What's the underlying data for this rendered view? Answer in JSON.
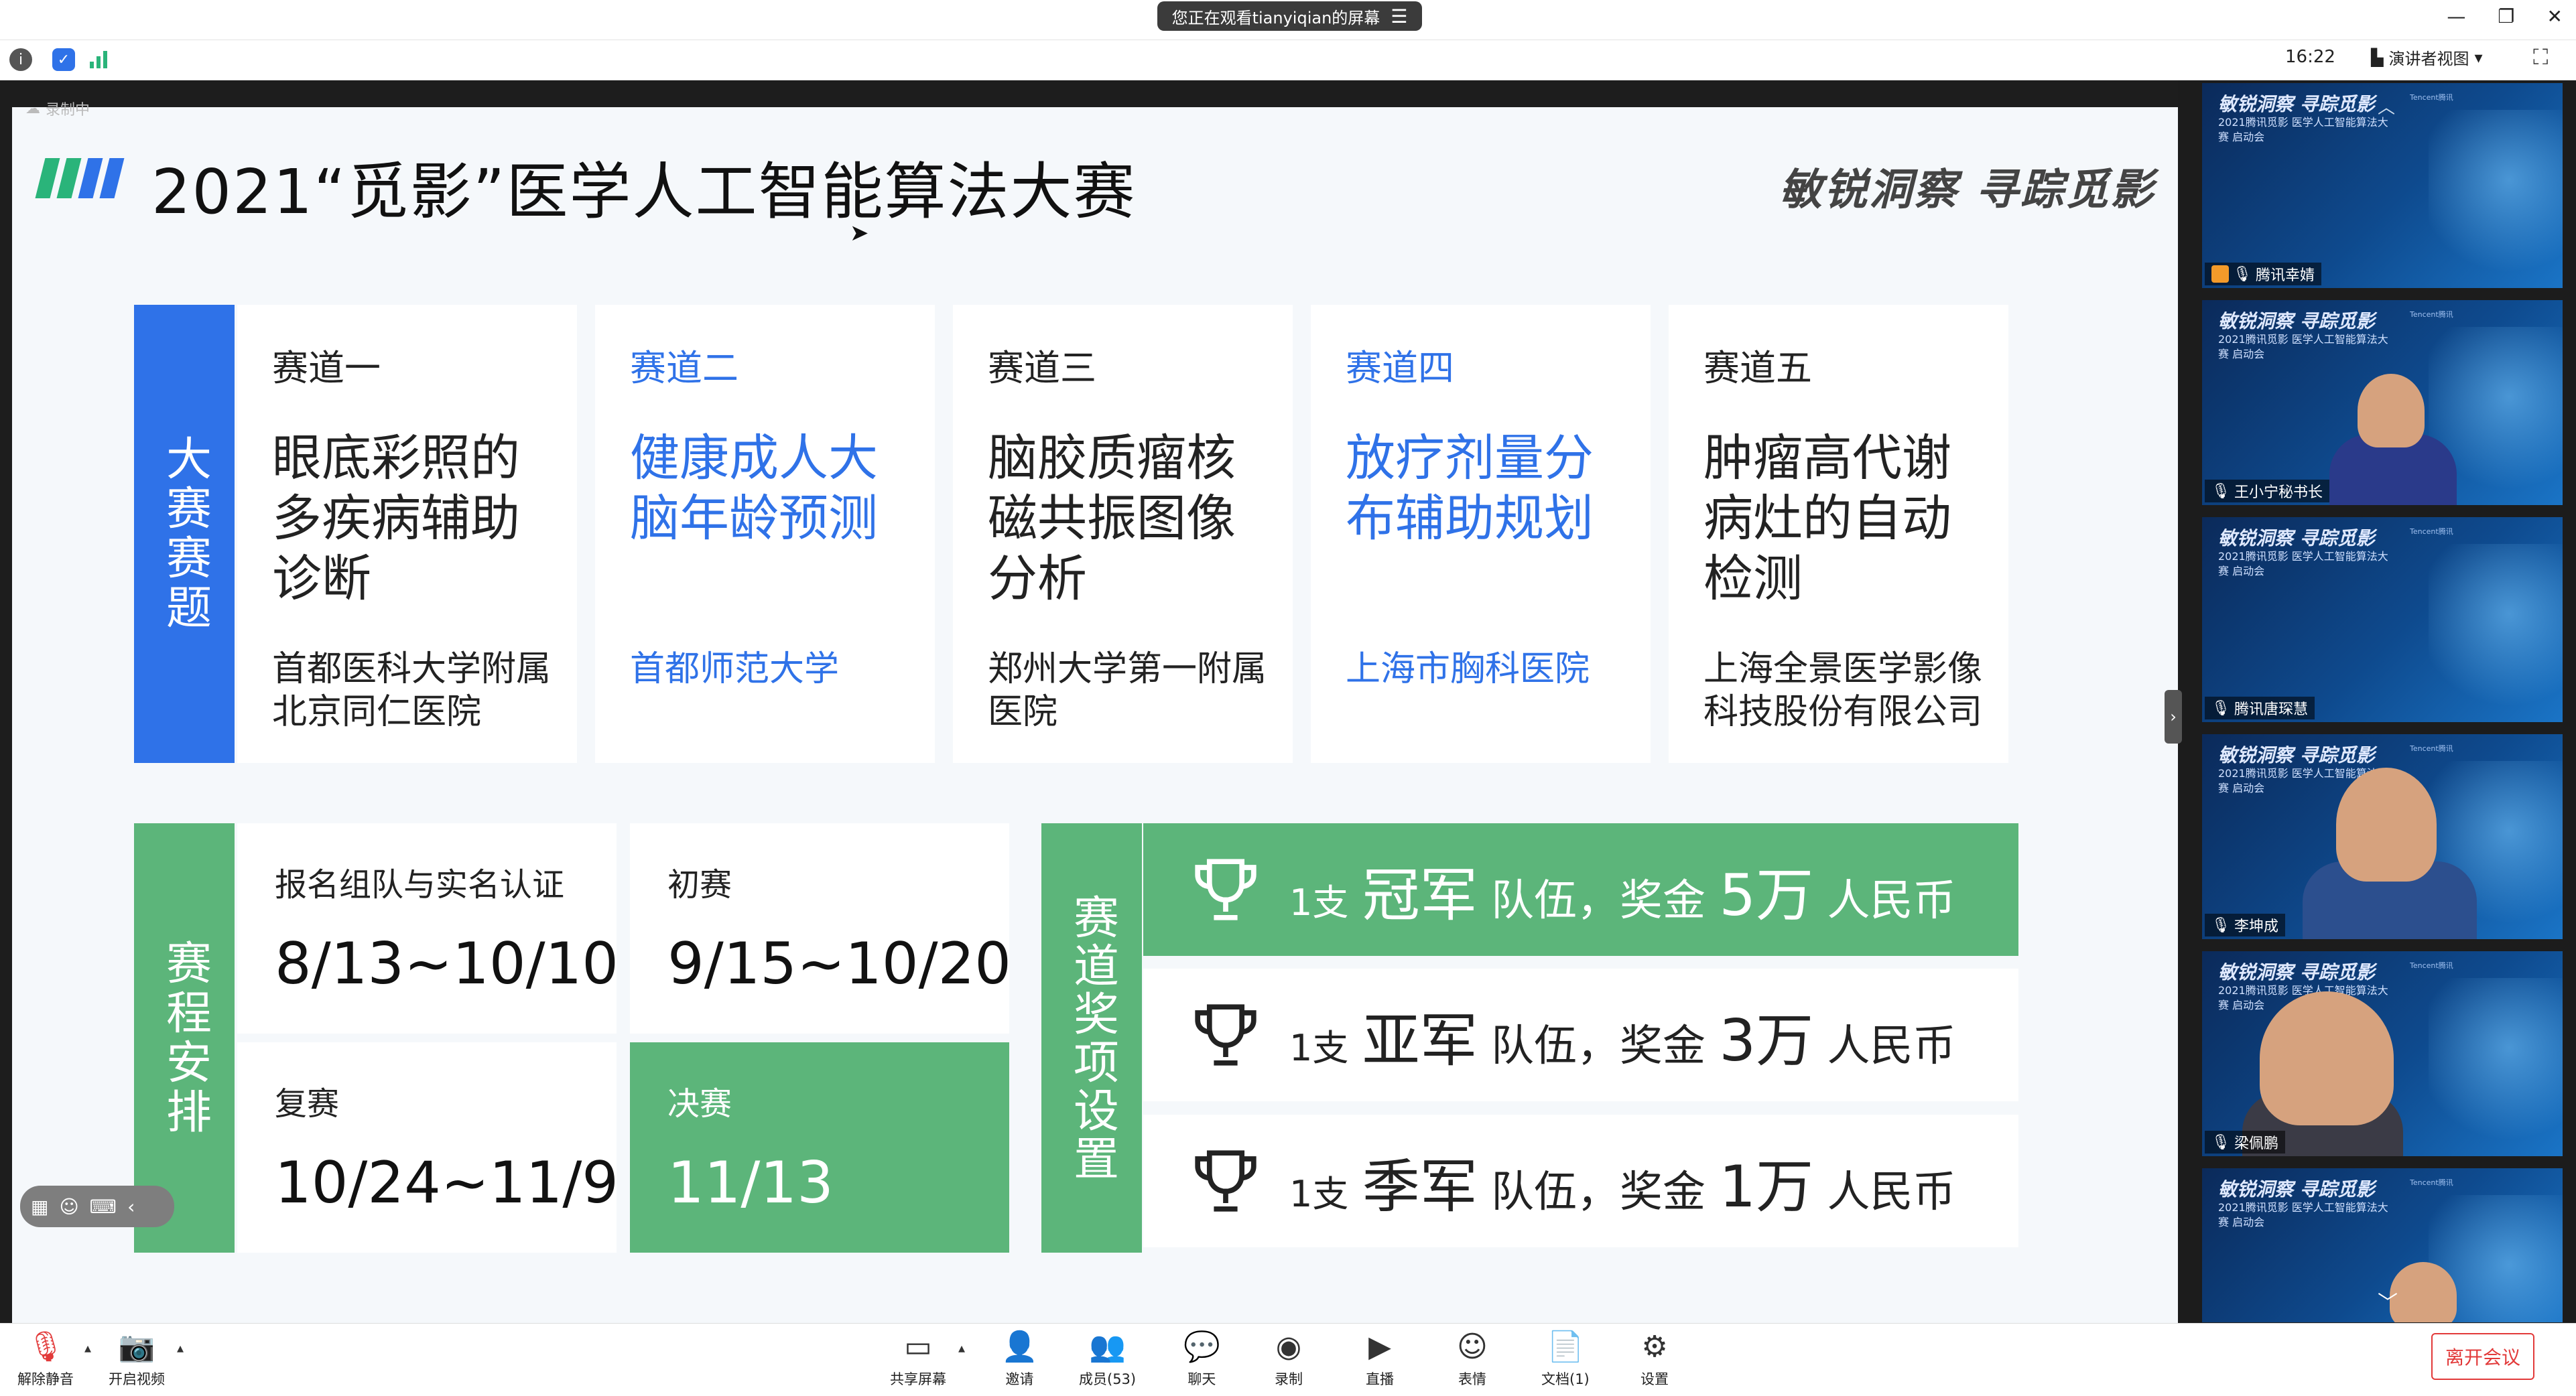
{
  "window": {
    "share_banner": "您正在观看tianyiqian的屏幕",
    "time": "16:22",
    "presenter_view": "演讲者视图",
    "recording": "录制中"
  },
  "slide": {
    "title": "2021“觅影”医学人工智能算法大赛",
    "slogan": "敏锐洞察 寻踪觅影",
    "tracks_label": "大赛赛题",
    "tracks": [
      {
        "name": "赛道一",
        "topic": "眼底彩照的多疾病辅助诊断",
        "org": "首都医科大学附属北京同仁医院"
      },
      {
        "name": "赛道二",
        "topic": "健康成人大脑年龄预测",
        "org": "首都师范大学"
      },
      {
        "name": "赛道三",
        "topic": "脑胶质瘤核磁共振图像分析",
        "org": "郑州大学第一附属医院"
      },
      {
        "name": "赛道四",
        "topic": "放疗剂量分布辅助规划",
        "org": "上海市胸科医院"
      },
      {
        "name": "赛道五",
        "topic": "肿瘤高代谢病灶的自动检测",
        "org": "上海全景医学影像科技股份有限公司"
      }
    ],
    "schedule_label": "赛程安排",
    "schedule": [
      {
        "label": "报名组队与实名认证",
        "date": "8/13~10/10"
      },
      {
        "label": "初赛",
        "date": "9/15~10/20"
      },
      {
        "label": "复赛",
        "date": "10/24~11/9"
      },
      {
        "label": "决赛",
        "date": "11/13"
      }
    ],
    "awards_label": "赛道奖项设置",
    "awards": [
      {
        "count": "1支",
        "rank": "冠军",
        "team": "队伍，奖金",
        "amount": "5万",
        "unit": "人民币"
      },
      {
        "count": "1支",
        "rank": "亚军",
        "team": "队伍，奖金",
        "amount": "3万",
        "unit": "人民币"
      },
      {
        "count": "1支",
        "rank": "季军",
        "team": "队伍，奖金",
        "amount": "1万",
        "unit": "人民币"
      }
    ]
  },
  "participants": {
    "tile_slogan": "敏锐洞察 寻踪觅影",
    "tile_info": "2021腾讯觅影 医学人工智能算法大赛 启动会",
    "tile_sponsor": "Tencent腾讯",
    "list": [
      {
        "name": "腾讯幸婧"
      },
      {
        "name": "王小宁秘书长"
      },
      {
        "name": "腾讯唐琛慧"
      },
      {
        "name": "李坤成"
      },
      {
        "name": "梁佩鹏"
      },
      {
        "name": ""
      }
    ]
  },
  "bottom_bar": {
    "mute": "解除静音",
    "video": "开启视频",
    "share": "共享屏幕",
    "invite": "邀请",
    "members": "成员(53)",
    "chat": "聊天",
    "record": "录制",
    "live": "直播",
    "emoji": "表情",
    "docs": "文档(1)",
    "settings": "设置",
    "leave": "离开会议"
  },
  "colors": {
    "blue_accent": "#2f72e8",
    "green_accent": "#5cb57a",
    "leave_red": "#e23a3a"
  }
}
